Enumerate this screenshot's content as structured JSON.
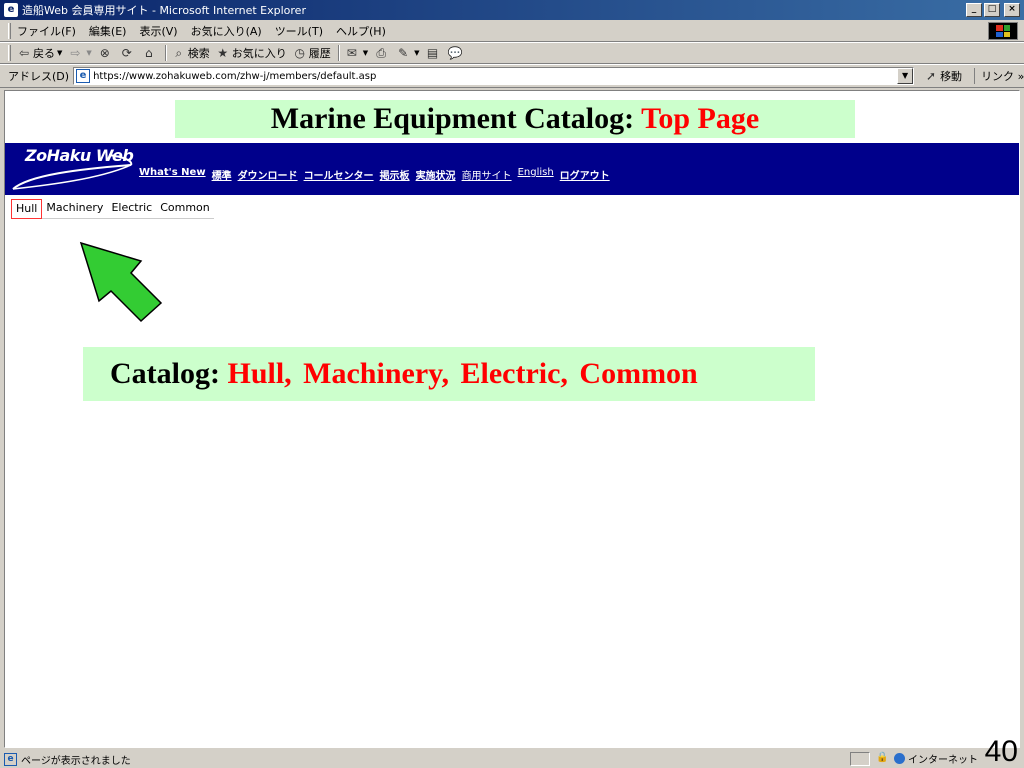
{
  "window": {
    "title": "造船Web 会員専用サイト - Microsoft Internet Explorer",
    "minimize": "_",
    "maximize": "□",
    "close": "×"
  },
  "menu": {
    "items": [
      "ファイル(F)",
      "編集(E)",
      "表示(V)",
      "お気に入り(A)",
      "ツール(T)",
      "ヘルプ(H)"
    ]
  },
  "toolbar": {
    "back": "戻る",
    "search": "検索",
    "favorites": "お気に入り",
    "history": "履歴"
  },
  "address": {
    "label": "アドレス(D)",
    "url": "https://www.zohakuweb.com/zhw-j/members/default.asp",
    "go": "移動",
    "links": "リンク"
  },
  "slide": {
    "title_main": "Marine Equipment Catalog:",
    "title_accent": "Top Page",
    "catalog_label": "Catalog:",
    "catalog_items": "Hull,  Machinery,  Electric,  Common",
    "page_number": "40"
  },
  "site": {
    "logo": "ZoHaku Web",
    "nav": [
      {
        "label": "What's New",
        "bold": true
      },
      {
        "label": "標準",
        "bold": true
      },
      {
        "label": "ダウンロード",
        "bold": true
      },
      {
        "label": "コールセンター",
        "bold": true
      },
      {
        "label": "掲示板",
        "bold": true
      },
      {
        "label": "実施状況",
        "bold": true
      },
      {
        "label": "商用サイト",
        "bold": false
      },
      {
        "label": "English",
        "bold": false
      },
      {
        "label": "ログアウト",
        "bold": true
      }
    ],
    "category_tabs": [
      "Hull",
      "Machinery",
      "Electric",
      "Common"
    ],
    "active_tab": "Hull"
  },
  "status": {
    "text": "ページが表示されました",
    "zone": "インターネット"
  },
  "colors": {
    "banner": "#00008b",
    "caption_bg": "#ccffcc",
    "accent": "#ff0000",
    "arrow": "#33cc33"
  }
}
